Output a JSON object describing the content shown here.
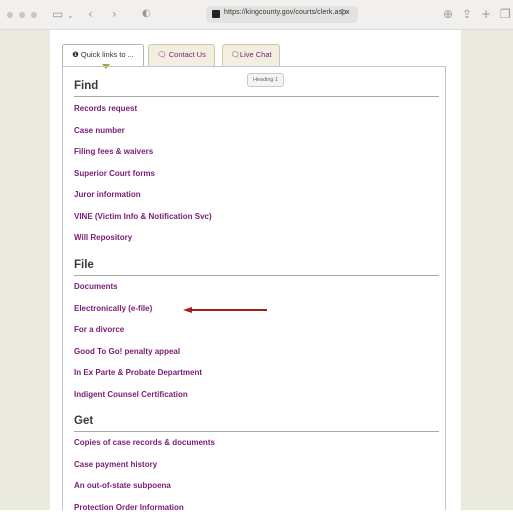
{
  "browser": {
    "url": "https://kingcounty.gov/courts/clerk.aspx",
    "icons": [
      "traffic-light",
      "sidebar-icon",
      "back-icon",
      "forward-icon",
      "shield-icon",
      "lock-icon",
      "reload-icon",
      "download-icon",
      "share-icon",
      "new-tab-icon",
      "tabs-overview-icon"
    ]
  },
  "tabs": [
    {
      "label": "❶ Quick links to ...",
      "active": true
    },
    {
      "label": "🗨 Contact Us",
      "active": false
    },
    {
      "label": "🗨Live Chat",
      "active": false
    }
  ],
  "tooltip": "Heading 1",
  "sections": [
    {
      "title": "Find",
      "links": [
        "Records request",
        "Case number",
        "Filing fees & waivers",
        "Superior Court forms",
        "Juror information",
        "VINE (Victim Info & Notification Svc)",
        "Will Repository"
      ]
    },
    {
      "title": "File",
      "links": [
        "Documents",
        "Electronically (e-file)",
        "For a divorce",
        "Good To Go! penalty appeal",
        "In Ex Parte & Probate Department",
        "Indigent Counsel Certification"
      ]
    },
    {
      "title": "Get",
      "links": [
        "Copies of case records & documents",
        "Case payment history",
        "An out-of-state subpoena",
        "Protection Order Information"
      ]
    }
  ],
  "colors": {
    "link": "#7b1c73",
    "arrow": "#a51d1d",
    "accent": "#8bb82d",
    "page_bg": "#ebeade"
  }
}
